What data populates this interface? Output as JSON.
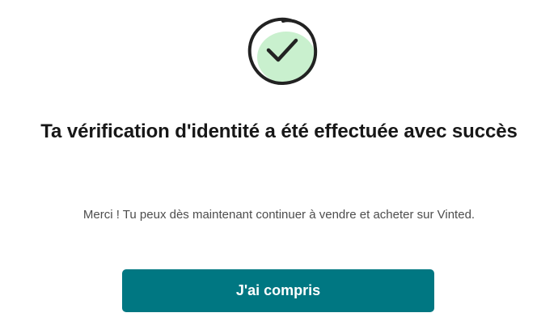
{
  "success": {
    "icon": "checkmark-circle-icon",
    "accent_color": "#c9f0ce",
    "stroke_color": "#222222"
  },
  "title": "Ta vérification d'identité a été effectuée avec succès",
  "message": "Merci ! Tu peux dès maintenant continuer à vendre et acheter sur Vinted.",
  "button": {
    "label": "J'ai compris",
    "color": "#007782"
  }
}
